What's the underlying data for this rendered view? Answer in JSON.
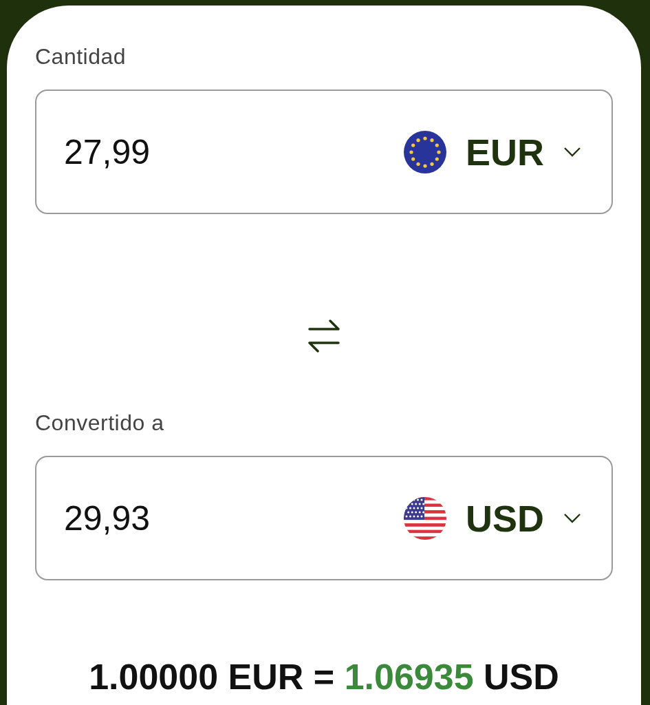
{
  "amount": {
    "label": "Cantidad",
    "value": "27,99",
    "currency": {
      "code": "EUR",
      "kind": "eu"
    }
  },
  "converted": {
    "label": "Convertido a",
    "value": "29,93",
    "currency": {
      "code": "USD",
      "kind": "us"
    }
  },
  "rate": {
    "from": "1.00000 EUR",
    "sign": "=",
    "value": "1.06935",
    "unit": "USD"
  }
}
